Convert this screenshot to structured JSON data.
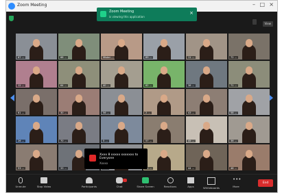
{
  "window": {
    "title": "Zoom Meeting"
  },
  "banner": {
    "title": "Zoom Meeting",
    "subtitle": "is viewing this application"
  },
  "top_buttons": [
    "",
    "View"
  ],
  "notification": {
    "title": "Xxxx 8 xxxxx xxxxxxx to Everyone",
    "subtitle": "Xxxxx"
  },
  "toolbar": {
    "items": [
      {
        "label": "Unmute",
        "icon": "microphone-icon"
      },
      {
        "label": "Stop Video",
        "icon": "video-camera-icon"
      },
      {
        "label": "Participants",
        "icon": "participants-icon"
      },
      {
        "label": "Chat",
        "icon": "chat-icon"
      },
      {
        "label": "Share Screen",
        "icon": "share-screen-icon"
      },
      {
        "label": "Reactions",
        "icon": "reactions-icon"
      },
      {
        "label": "Apps",
        "icon": "apps-icon"
      },
      {
        "label": "Whiteboards",
        "icon": "whiteboard-icon"
      },
      {
        "label": "More",
        "icon": "more-icon"
      }
    ],
    "end": "End"
  },
  "participants": [
    {
      "name": "67 ...",
      "bg": "#8a8f96"
    },
    {
      "name": "68 ...",
      "bg": "#7f8e7a"
    },
    {
      "name": "Mister ...",
      "bg": "#b89a87"
    },
    {
      "name": "69 ...",
      "bg": "#9aa0a8"
    },
    {
      "name": "11 ...",
      "bg": "#a19487"
    },
    {
      "name": "72 ...",
      "bg": "#7a7268"
    },
    {
      "name": "12 ...",
      "bg": "#b07f8f"
    },
    {
      "name": "64 ...",
      "bg": "#8e8f7a"
    },
    {
      "name": "40 ...",
      "bg": "#a49e90"
    },
    {
      "name": "62 ...",
      "bg": "#78b46a"
    },
    {
      "name": "38 ...",
      "bg": "#6f7880"
    },
    {
      "name": "71 ...",
      "bg": "#8c8d7a"
    },
    {
      "name": "61 ...",
      "bg": "#7a6f6a"
    },
    {
      "name": "30 ...",
      "bg": "#9b7d75"
    },
    {
      "name": "56 ...",
      "bg": "#8b8f95"
    },
    {
      "name": "2 ...",
      "bg": "#b09a87"
    },
    {
      "name": "43 ...",
      "bg": "#8d7e74"
    },
    {
      "name": "58 ...",
      "bg": "#a0a2a6"
    },
    {
      "name": "26 ...",
      "bg": "#5f84b8"
    },
    {
      "name": "70 ...",
      "bg": "#7a7c84"
    },
    {
      "name": "5 ...",
      "bg": "#7d8a9c"
    },
    {
      "name": "57 ...",
      "bg": "#8a7d70"
    },
    {
      "name": "45 ...",
      "bg": "#c8c0b5"
    },
    {
      "name": "36 ...",
      "bg": "#a09a92"
    },
    {
      "name": "53 ...",
      "bg": "#8a7c72"
    },
    {
      "name": "33 ...",
      "bg": "#6e7278"
    },
    {
      "name": "5 ...",
      "bg": "#8e9094"
    },
    {
      "name": "31 ...",
      "bg": "#b7a98a"
    },
    {
      "name": "44 ...",
      "bg": "#6f6458"
    },
    {
      "name": "48 ...",
      "bg": "#9a7c6b"
    }
  ]
}
